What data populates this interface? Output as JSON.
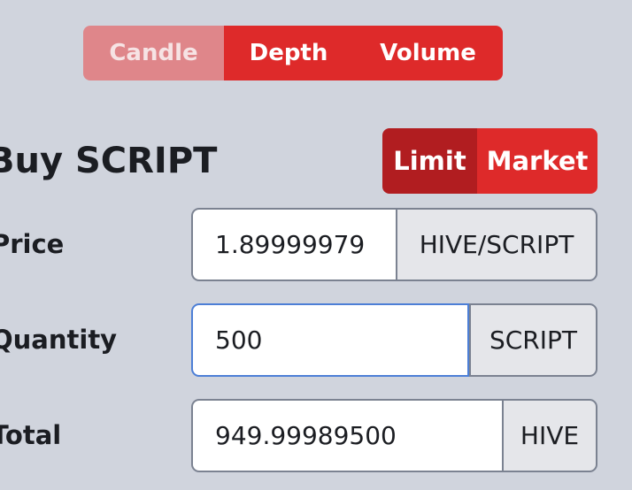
{
  "chart_tabs": {
    "items": [
      {
        "id": "candle",
        "label": "Candle",
        "active": false
      },
      {
        "id": "depth",
        "label": "Depth",
        "active": true
      },
      {
        "id": "volume",
        "label": "Volume",
        "active": true
      }
    ]
  },
  "order_form": {
    "title": "Buy SCRIPT",
    "order_types": {
      "limit_label": "Limit",
      "market_label": "Market",
      "selected": "Limit"
    },
    "price": {
      "label": "Price",
      "value": "1.89999979",
      "unit": "HIVE/SCRIPT"
    },
    "quantity": {
      "label": "Quantity",
      "value": "500",
      "unit": "SCRIPT"
    },
    "total": {
      "label": "Total",
      "value": "949.99989500",
      "unit": "HIVE"
    }
  },
  "colors": {
    "accent_red": "#de2a2a",
    "accent_red_active": "#b11d20",
    "accent_red_inactive": "#df868a",
    "focus_blue": "#4d7fd6",
    "background": "#d0d4dd"
  }
}
